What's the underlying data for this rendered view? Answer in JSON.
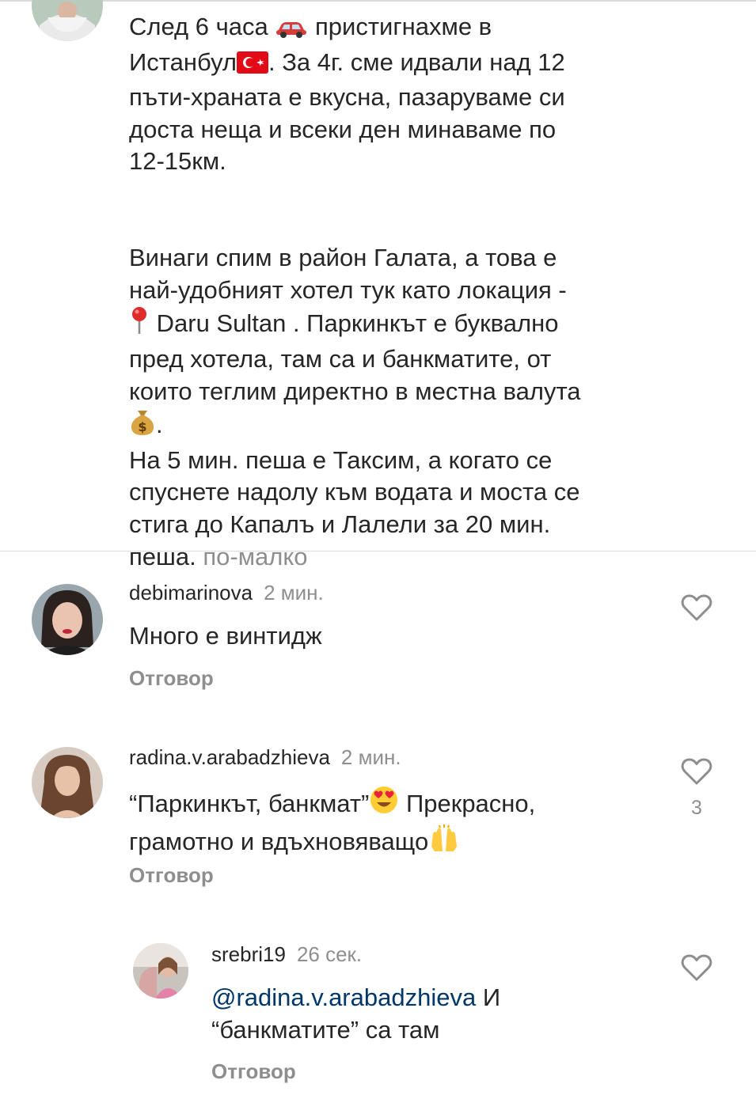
{
  "post": {
    "caption_lines_1": [
      "След 6 часа",
      "пристигнахме в",
      "Истанбул",
      ". За 4г. сме идвали над 12",
      "пъти-храната е вкусна, пазаруваме си",
      "доста неща и всеки ден минаваме по",
      "12-15км."
    ],
    "caption_lines_2": [
      "Винаги спим в район Галата, а това е",
      "най-удобният хотел тук като локация -",
      "Daru Sultan . Паркинкът е буквално",
      "пред хотела, там са и банкматите, от",
      "които теглим директно в местна валута",
      ".",
      "На 5 мин. пеша е Таксим, а когато се",
      "спуснете надолу към водата и моста се",
      "стига до Капалъ и Лалели за 20 мин.",
      "пеша."
    ],
    "less_label": "по-малко",
    "icons": [
      "car-emoji",
      "turkey-flag-emoji",
      "pin-emoji",
      "money-bag-emoji"
    ]
  },
  "comments": [
    {
      "username": "debimarinova",
      "time": "2 мин.",
      "text": "Много е винтидж",
      "reply_label": "Отговор",
      "likes": ""
    },
    {
      "username": "radina.v.arabadzhieva",
      "time": "2 мин.",
      "text_1": "“Паркинкът, банкмат”",
      "text_2": " Прекрасно,",
      "text_3": "грамотно и вдъхновяващо",
      "reply_label": "Отговор",
      "likes": "3"
    },
    {
      "username": "srebri19",
      "time": "26 сек.",
      "mention": "@radina.v.arabadzhieva",
      "text_1": " И",
      "text_2": "“банкматите” са там",
      "reply_label": "Отговор",
      "likes": ""
    }
  ],
  "colors": {
    "text": "#262626",
    "secondary": "#8e8e8e",
    "mention": "#00376b",
    "divider": "#dbdbdb"
  }
}
